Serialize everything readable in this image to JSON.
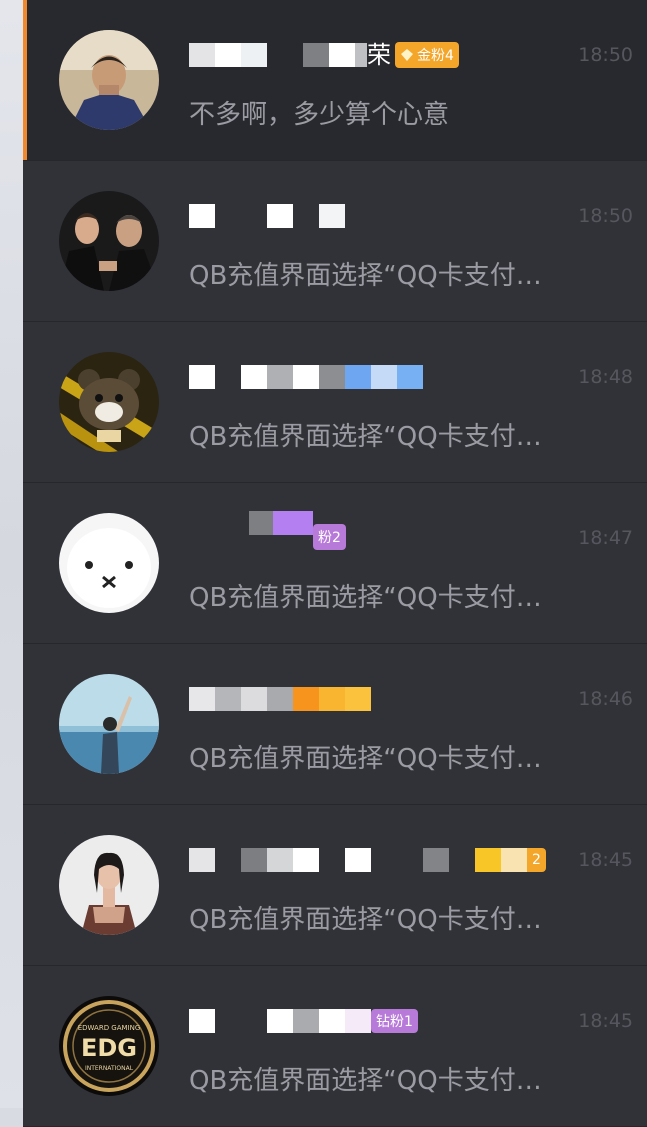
{
  "conversations": [
    {
      "name_tail": "荣",
      "badge": "金粉4",
      "time": "18:50",
      "preview": "不多啊，多少算个心意"
    },
    {
      "name_tail": "",
      "badge": "",
      "time": "18:50",
      "preview": "QB充值界面选择“QQ卡支付…"
    },
    {
      "name_tail": "",
      "badge": "",
      "time": "18:48",
      "preview": "QB充值界面选择“QQ卡支付…"
    },
    {
      "name_tail": "",
      "badge": "粉2",
      "time": "18:47",
      "preview": "QB充值界面选择“QQ卡支付…"
    },
    {
      "name_tail": "",
      "badge": "",
      "time": "18:46",
      "preview": "QB充值界面选择“QQ卡支付…"
    },
    {
      "name_tail": "",
      "badge": "2",
      "time": "18:45",
      "preview": "QB充值界面选择“QQ卡支付…"
    },
    {
      "name_tail": "",
      "badge": "钻粉1",
      "time": "18:45",
      "preview": "QB充值界面选择“QQ卡支付…"
    }
  ],
  "avatars": [
    "man-in-graduation-gown",
    "two-men-in-suits",
    "bear-mascot",
    "white-round-character",
    "person-at-sea",
    "woman-portrait",
    "edg-logo"
  ],
  "avatar_logo_text": {
    "top": "EDWARD GAMING",
    "main": "EDG",
    "bottom": "INTERNATIONAL"
  },
  "colors": {
    "active_accent": "#f0892b",
    "gold_badge": "#f4a62a",
    "purple_badge": "#b77ad9"
  }
}
